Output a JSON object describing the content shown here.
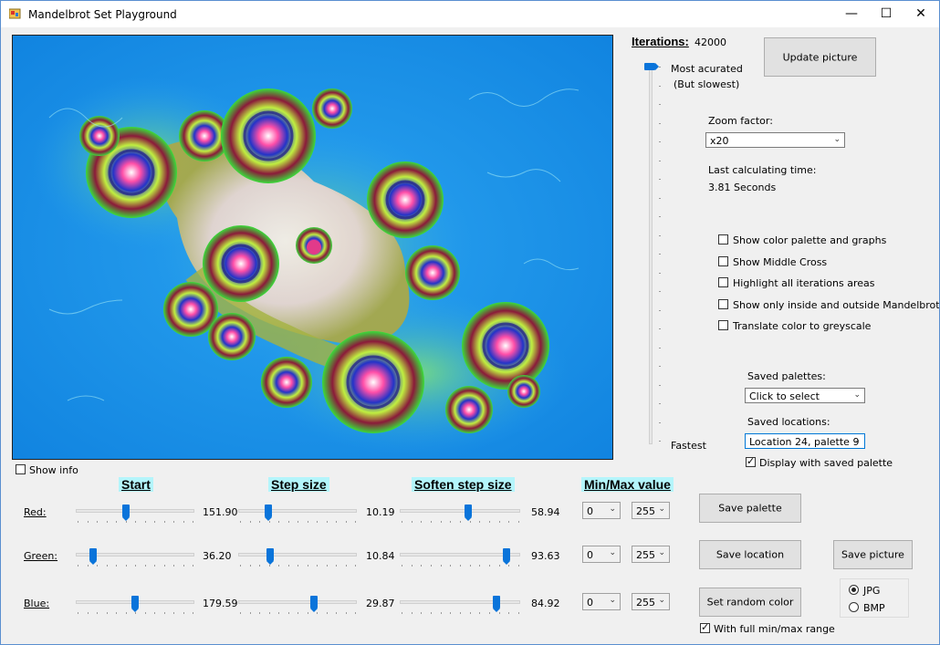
{
  "window": {
    "title": "Mandelbrot Set Playground",
    "minimize": "—",
    "maximize": "☐",
    "close": "✕"
  },
  "iterations": {
    "label": "Iterations:",
    "value": "42000",
    "top_label": "Most acurated",
    "top_sublabel": "(But slowest)",
    "bottom_label": "Fastest",
    "slider_level": 1.0
  },
  "buttons": {
    "update": "Update picture",
    "save_palette": "Save  palette",
    "save_location": "Save location",
    "save_picture": "Save picture",
    "random_color": "Set random color"
  },
  "zoom": {
    "label": "Zoom factor:",
    "value": "x20"
  },
  "calc_time": {
    "label": "Last calculating time:",
    "value": "3.81 Seconds"
  },
  "options": [
    {
      "label": "Show color palette and graphs",
      "checked": false
    },
    {
      "label": "Show Middle Cross",
      "checked": false
    },
    {
      "label": "Highlight all iterations areas",
      "checked": false
    },
    {
      "label": "Show only inside and outside Mandelbrot areas",
      "checked": false
    },
    {
      "label": "Translate color to greyscale",
      "checked": false
    }
  ],
  "saved_palettes": {
    "label": "Saved palettes:",
    "value": "Click to select"
  },
  "saved_locations": {
    "label": "Saved locations:",
    "value": "Location 24, palette 9"
  },
  "display_saved_palette": {
    "label": "Display with saved palette",
    "checked": true
  },
  "show_info": {
    "label": "Show info",
    "checked": false
  },
  "headers": {
    "start": "Start",
    "step": "Step size",
    "soften": "Soften step size",
    "minmax": "Min/Max value"
  },
  "rows": [
    {
      "label": "Red:",
      "start": "151.90",
      "step": "10.19",
      "soften": "58.94",
      "min": "0",
      "max": "255",
      "start_pos": 0.42,
      "step_pos": 0.24,
      "soften_pos": 0.57
    },
    {
      "label": "Green:",
      "start": "36.20",
      "step": "10.84",
      "soften": "93.63",
      "min": "0",
      "max": "255",
      "start_pos": 0.12,
      "step_pos": 0.25,
      "soften_pos": 0.91
    },
    {
      "label": "Blue:",
      "start": "179.59",
      "step": "29.87",
      "soften": "84.92",
      "min": "0",
      "max": "255",
      "start_pos": 0.5,
      "step_pos": 0.65,
      "soften_pos": 0.82
    }
  ],
  "full_range": {
    "label": "With full min/max range",
    "checked": true
  },
  "format": {
    "options": [
      {
        "label": "JPG",
        "checked": true
      },
      {
        "label": "BMP",
        "checked": false
      }
    ]
  },
  "colors": {
    "fractal_bg": "#1a8fe6",
    "accent": "#0a74da",
    "header_bg": "#b4f5fb"
  }
}
